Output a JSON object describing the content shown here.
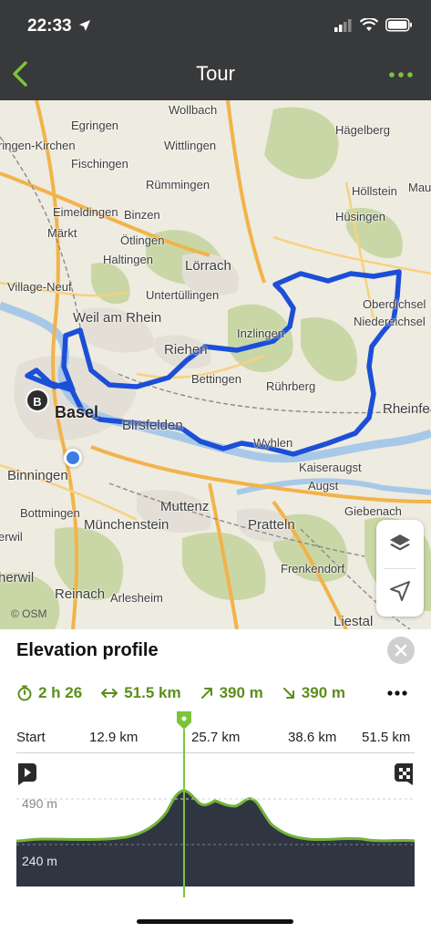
{
  "status": {
    "time": "22:33"
  },
  "header": {
    "title": "Tour"
  },
  "map": {
    "attribution": "© OSM",
    "start_marker": "B",
    "places": [
      {
        "name": "Wollbach",
        "cls": ""
      },
      {
        "name": "Egringen",
        "cls": ""
      },
      {
        "name": "Hägelberg",
        "cls": ""
      },
      {
        "name": "ringen-Kirchen",
        "cls": ""
      },
      {
        "name": "Wittlingen",
        "cls": ""
      },
      {
        "name": "Fischingen",
        "cls": ""
      },
      {
        "name": "Höllstein",
        "cls": ""
      },
      {
        "name": "Mau",
        "cls": ""
      },
      {
        "name": "Rümmingen",
        "cls": ""
      },
      {
        "name": "Eimeldingen",
        "cls": ""
      },
      {
        "name": "Binzen",
        "cls": ""
      },
      {
        "name": "Hüsingen",
        "cls": ""
      },
      {
        "name": "Märkt",
        "cls": ""
      },
      {
        "name": "Ötlingen",
        "cls": ""
      },
      {
        "name": "Haltingen",
        "cls": ""
      },
      {
        "name": "Lörrach",
        "cls": "big"
      },
      {
        "name": "Village-Neuf",
        "cls": ""
      },
      {
        "name": "Untertüllingen",
        "cls": ""
      },
      {
        "name": "Oberdichsel",
        "cls": ""
      },
      {
        "name": "Weil am Rhein",
        "cls": "big"
      },
      {
        "name": "Niedereichsel",
        "cls": ""
      },
      {
        "name": "Inzlingen",
        "cls": ""
      },
      {
        "name": "Riehen",
        "cls": "big"
      },
      {
        "name": "Bettingen",
        "cls": ""
      },
      {
        "name": "Rührberg",
        "cls": ""
      },
      {
        "name": "Rheinfe",
        "cls": "big"
      },
      {
        "name": "Basel",
        "cls": "huge"
      },
      {
        "name": "Birsfelden",
        "cls": "big"
      },
      {
        "name": "Wyhlen",
        "cls": ""
      },
      {
        "name": "Kaiseraugst",
        "cls": ""
      },
      {
        "name": "Binningen",
        "cls": "big"
      },
      {
        "name": "Augst",
        "cls": ""
      },
      {
        "name": "Giebenach",
        "cls": ""
      },
      {
        "name": "Muttenz",
        "cls": "big"
      },
      {
        "name": "Bottmingen",
        "cls": ""
      },
      {
        "name": "erwil",
        "cls": ""
      },
      {
        "name": "Münchenstein",
        "cls": "big"
      },
      {
        "name": "Pratteln",
        "cls": "big"
      },
      {
        "name": "herwil",
        "cls": "big"
      },
      {
        "name": "Frenkendorf",
        "cls": ""
      },
      {
        "name": "Reinach",
        "cls": "big"
      },
      {
        "name": "Arlesheim",
        "cls": ""
      },
      {
        "name": "Liestal",
        "cls": "big"
      }
    ]
  },
  "sheet": {
    "title": "Elevation profile",
    "stats": {
      "duration": "2 h 26",
      "distance": "51.5 km",
      "ascent": "390 m",
      "descent": "390 m"
    },
    "axis": [
      "Start",
      "12.9 km",
      "25.7 km",
      "38.6 km",
      "51.5 km"
    ],
    "elevation_labels": {
      "max": "490 m",
      "min": "240 m"
    }
  },
  "colors": {
    "accent": "#7cc43a",
    "route": "#1c4fd8",
    "header_bg": "#38393b",
    "profile_fill": "#2f3642",
    "profile_stroke": "#74b43a"
  }
}
